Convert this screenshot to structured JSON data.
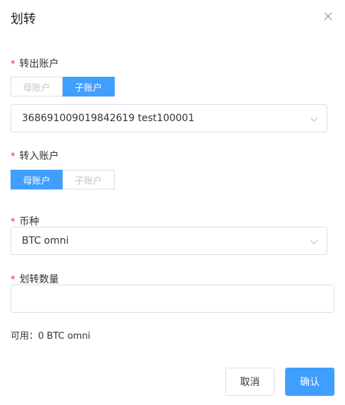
{
  "dialog": {
    "title": "划转"
  },
  "from_account": {
    "required_mark": "*",
    "label": "转出账户",
    "options": [
      "母账户",
      "子账户"
    ],
    "selected": "子账户",
    "account_value": "368691009019842619 test100001"
  },
  "to_account": {
    "required_mark": "*",
    "label": "转入账户",
    "options": [
      "母账户",
      "子账户"
    ],
    "selected": "母账户"
  },
  "currency": {
    "required_mark": "*",
    "label": "币种",
    "value": "BTC omni"
  },
  "amount": {
    "required_mark": "*",
    "label": "划转数量",
    "value": ""
  },
  "available": {
    "text": "可用：0 BTC omni"
  },
  "buttons": {
    "cancel": "取消",
    "confirm": "确认"
  },
  "colors": {
    "accent": "#409eff",
    "required": "#f5222d",
    "border": "#dcdfe6"
  }
}
